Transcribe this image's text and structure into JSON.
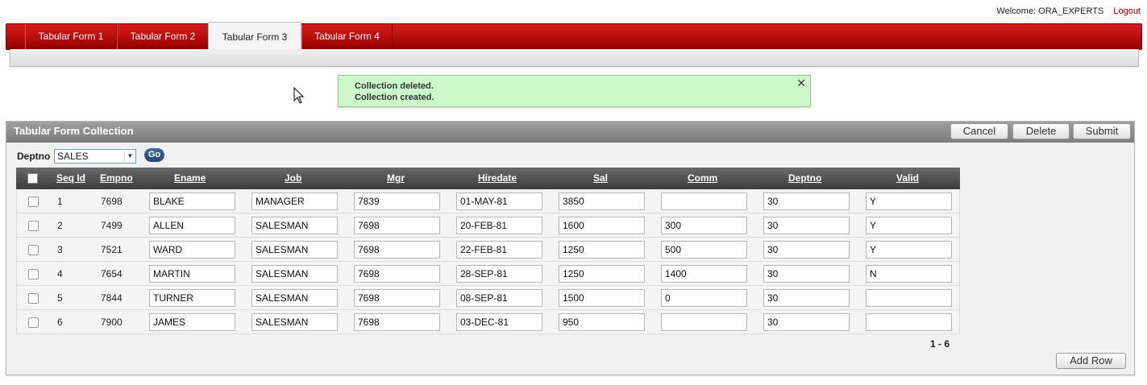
{
  "header": {
    "welcome": "Welcome: ORA_EXPERTS",
    "logout": "Logout"
  },
  "tabs": [
    {
      "label": "Tabular Form 1"
    },
    {
      "label": "Tabular Form 2"
    },
    {
      "label": "Tabular Form 3",
      "active": true
    },
    {
      "label": "Tabular Form 4"
    }
  ],
  "message": {
    "line1": "Collection deleted.",
    "line2": "Collection created.",
    "close": "✕"
  },
  "region": {
    "title": "Tabular Form Collection",
    "buttons": {
      "cancel": "Cancel",
      "delete": "Delete",
      "submit": "Submit",
      "add_row": "Add Row"
    },
    "filter": {
      "label": "Deptno",
      "value": "SALES",
      "go": "Go"
    },
    "columns": [
      "Seq Id",
      "Empno",
      "Ename",
      "Job",
      "Mgr",
      "Hiredate",
      "Sal",
      "Comm",
      "Deptno",
      "Valid"
    ],
    "rows": [
      {
        "seq": "1",
        "empno": "7698",
        "ename": "BLAKE",
        "job": "MANAGER",
        "mgr": "7839",
        "hiredate": "01-MAY-81",
        "sal": "3850",
        "comm": "",
        "deptno": "30",
        "valid": "Y"
      },
      {
        "seq": "2",
        "empno": "7499",
        "ename": "ALLEN",
        "job": "SALESMAN",
        "mgr": "7698",
        "hiredate": "20-FEB-81",
        "sal": "1600",
        "comm": "300",
        "deptno": "30",
        "valid": "Y"
      },
      {
        "seq": "3",
        "empno": "7521",
        "ename": "WARD",
        "job": "SALESMAN",
        "mgr": "7698",
        "hiredate": "22-FEB-81",
        "sal": "1250",
        "comm": "500",
        "deptno": "30",
        "valid": "Y"
      },
      {
        "seq": "4",
        "empno": "7654",
        "ename": "MARTIN",
        "job": "SALESMAN",
        "mgr": "7698",
        "hiredate": "28-SEP-81",
        "sal": "1250",
        "comm": "1400",
        "deptno": "30",
        "valid": "N"
      },
      {
        "seq": "5",
        "empno": "7844",
        "ename": "TURNER",
        "job": "SALESMAN",
        "mgr": "7698",
        "hiredate": "08-SEP-81",
        "sal": "1500",
        "comm": "0",
        "deptno": "30",
        "valid": ""
      },
      {
        "seq": "6",
        "empno": "7900",
        "ename": "JAMES",
        "job": "SALESMAN",
        "mgr": "7698",
        "hiredate": "03-DEC-81",
        "sal": "950",
        "comm": "",
        "deptno": "30",
        "valid": ""
      }
    ],
    "pagination": "1 - 6"
  },
  "colors": {
    "tab_red": "#b80d0d",
    "message_green": "#ccf8cc",
    "region_header": "#8c8c8c"
  }
}
